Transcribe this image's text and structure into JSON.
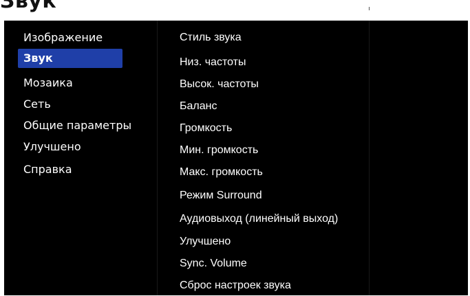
{
  "heading": "Звук",
  "main_menu": {
    "items": [
      {
        "label": "Изображение"
      },
      {
        "label": "Звук",
        "selected": true
      },
      {
        "label": "Мозаика"
      },
      {
        "label": "Сеть"
      },
      {
        "label": "Общие параметры"
      },
      {
        "label": "Улучшено"
      },
      {
        "label": "Справка"
      }
    ]
  },
  "sub_menu": {
    "items": [
      {
        "label": "Стиль звука"
      },
      {
        "label": "Низ. частоты"
      },
      {
        "label": "Высок. частоты"
      },
      {
        "label": "Баланс"
      },
      {
        "label": "Громкость"
      },
      {
        "label": "Мин. громкость"
      },
      {
        "label": "Макс. громкость"
      },
      {
        "label": "Режим Surround"
      },
      {
        "label": "Аудиовыход (линейный выход)"
      },
      {
        "label": "Улучшено"
      },
      {
        "label": "Sync. Volume"
      },
      {
        "label": "Сброс настроек звука"
      }
    ]
  },
  "colors": {
    "panel_background": "#000000",
    "selection_highlight": "#1f3fa8",
    "text": "#ffffff"
  }
}
